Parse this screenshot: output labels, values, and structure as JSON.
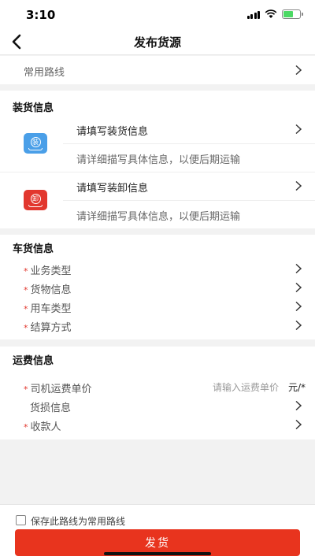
{
  "status_bar": {
    "time": "3:10"
  },
  "header": {
    "title": "发布货源"
  },
  "common_route": {
    "label": "常用路线"
  },
  "loading_section": {
    "title": "装货信息",
    "load": {
      "icon_char": "装",
      "title": "请填写装货信息",
      "hint": "请详细描写具体信息，以便后期运输",
      "color": "#4a9fe8"
    },
    "unload": {
      "icon_char": "卸",
      "title": "请填写装卸信息",
      "hint": "请详细描写具体信息，以便后期运输",
      "color": "#e2372e"
    }
  },
  "vehicle_section": {
    "title": "车货信息",
    "items": [
      {
        "label": "业务类型",
        "required": true
      },
      {
        "label": "货物信息",
        "required": true
      },
      {
        "label": "用车类型",
        "required": true
      },
      {
        "label": "结算方式",
        "required": true
      }
    ]
  },
  "freight_section": {
    "title": "运费信息",
    "unit_price": {
      "label": "司机运费单价",
      "placeholder": "请输入运费单价",
      "unit": "元/*"
    },
    "damage": {
      "label": "货损信息"
    },
    "payee": {
      "label": "收款人"
    }
  },
  "footer": {
    "save_route_label": "保存此路线为常用路线",
    "submit_label": "发货"
  },
  "star": "*"
}
